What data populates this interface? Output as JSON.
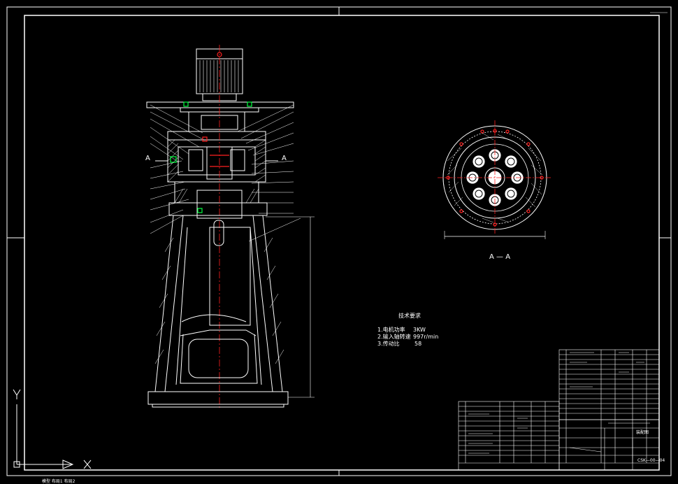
{
  "drawing": {
    "section_marker_letter": "A",
    "section_view_title": "A — A",
    "technical_requirements": {
      "heading": "技术要求",
      "items": [
        {
          "label": "1.电机功率",
          "value": "3KW"
        },
        {
          "label": "2.输入轴转速",
          "value": "997r/min"
        },
        {
          "label": "3.传动比",
          "value": "58"
        }
      ]
    },
    "title_block": {
      "drawing_number": "CSK—00—04",
      "name": "装配图"
    },
    "ucs_icon": {
      "y_label": "Y",
      "x_label": "X"
    },
    "bottom_strip_text": "模型 布局1 布局2"
  },
  "colors": {
    "background": "#000000",
    "lines": "#ffffff",
    "accent_red": "#ff2020",
    "accent_green": "#00ff40",
    "accent_cyan": "#00ffff",
    "accent_yellow": "#ffff00"
  }
}
